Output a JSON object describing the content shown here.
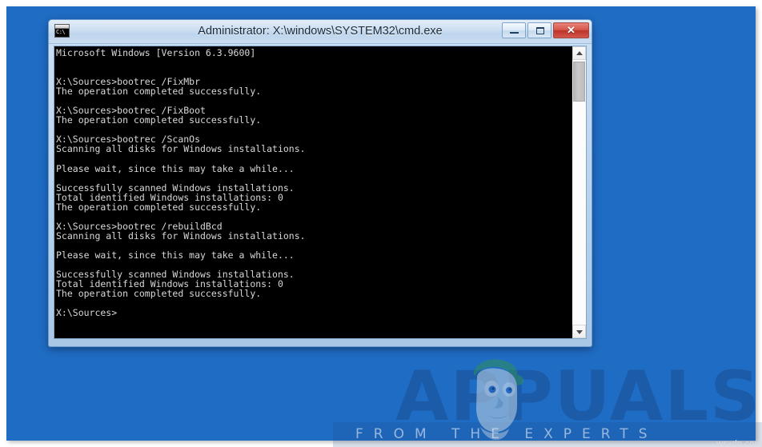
{
  "window": {
    "title": "Administrator: X:\\windows\\SYSTEM32\\cmd.exe",
    "icon_label": "C:\\",
    "controls": {
      "minimize": "–",
      "maximize": "□",
      "close": "✕"
    }
  },
  "console": {
    "text": "Microsoft Windows [Version 6.3.9600]\n\n\nX:\\Sources>bootrec /FixMbr\nThe operation completed successfully.\n\nX:\\Sources>bootrec /FixBoot\nThe operation completed successfully.\n\nX:\\Sources>bootrec /ScanOs\nScanning all disks for Windows installations.\n\nPlease wait, since this may take a while...\n\nSuccessfully scanned Windows installations.\nTotal identified Windows installations: 0\nThe operation completed successfully.\n\nX:\\Sources>bootrec /rebuildBcd\nScanning all disks for Windows installations.\n\nPlease wait, since this may take a while...\n\nSuccessfully scanned Windows installations.\nTotal identified Windows installations: 0\nThe operation completed successfully.\n\nX:\\Sources>",
    "lines": [
      "Microsoft Windows [Version 6.3.9600]",
      "",
      "",
      "X:\\Sources>bootrec /FixMbr",
      "The operation completed successfully.",
      "",
      "X:\\Sources>bootrec /FixBoot",
      "The operation completed successfully.",
      "",
      "X:\\Sources>bootrec /ScanOs",
      "Scanning all disks for Windows installations.",
      "",
      "Please wait, since this may take a while...",
      "",
      "Successfully scanned Windows installations.",
      "Total identified Windows installations: 0",
      "The operation completed successfully.",
      "",
      "X:\\Sources>bootrec /rebuildBcd",
      "Scanning all disks for Windows installations.",
      "",
      "Please wait, since this may take a while...",
      "",
      "Successfully scanned Windows installations.",
      "Total identified Windows installations: 0",
      "The operation completed successfully.",
      "",
      "X:\\Sources>"
    ]
  },
  "scrollbar": {
    "up_arrow": "⌃",
    "down_arrow": "⌄"
  },
  "watermark": {
    "brand": "APPUALS",
    "tagline": "FROM THE EXPERTS",
    "credit": "wsxdn.com"
  },
  "colors": {
    "desktop_background": "#1f6cc4",
    "console_background": "#000000",
    "console_text": "#d8d8d8",
    "titlebar_text": "#1a2a3a",
    "close_button": "#bc342a",
    "window_frame": "#bcd4ec"
  }
}
